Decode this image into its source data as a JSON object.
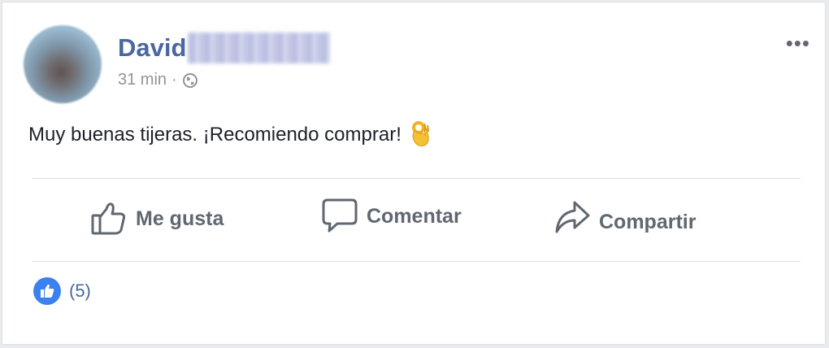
{
  "post": {
    "author": "David",
    "time": "31 min",
    "separator": "·",
    "text": "Muy buenas tijeras. ¡Recomiendo comprar!",
    "more_label": "•••",
    "like_count": "(5)"
  },
  "actions": {
    "like_label": "Me gusta",
    "comment_label": "Comentar",
    "share_label": "Compartir"
  },
  "icons": {
    "globe": "globe-icon",
    "more": "more-options-icon",
    "ok_emoji": "ok-hand-emoji-icon",
    "like": "thumbs-up-icon",
    "comment": "comment-bubble-icon",
    "share": "share-arrow-icon",
    "like_badge": "like-badge-icon"
  },
  "colors": {
    "author": "#4b67a1",
    "action_text": "#606770",
    "like_badge": "#3b82f0",
    "meta": "#90949c"
  }
}
